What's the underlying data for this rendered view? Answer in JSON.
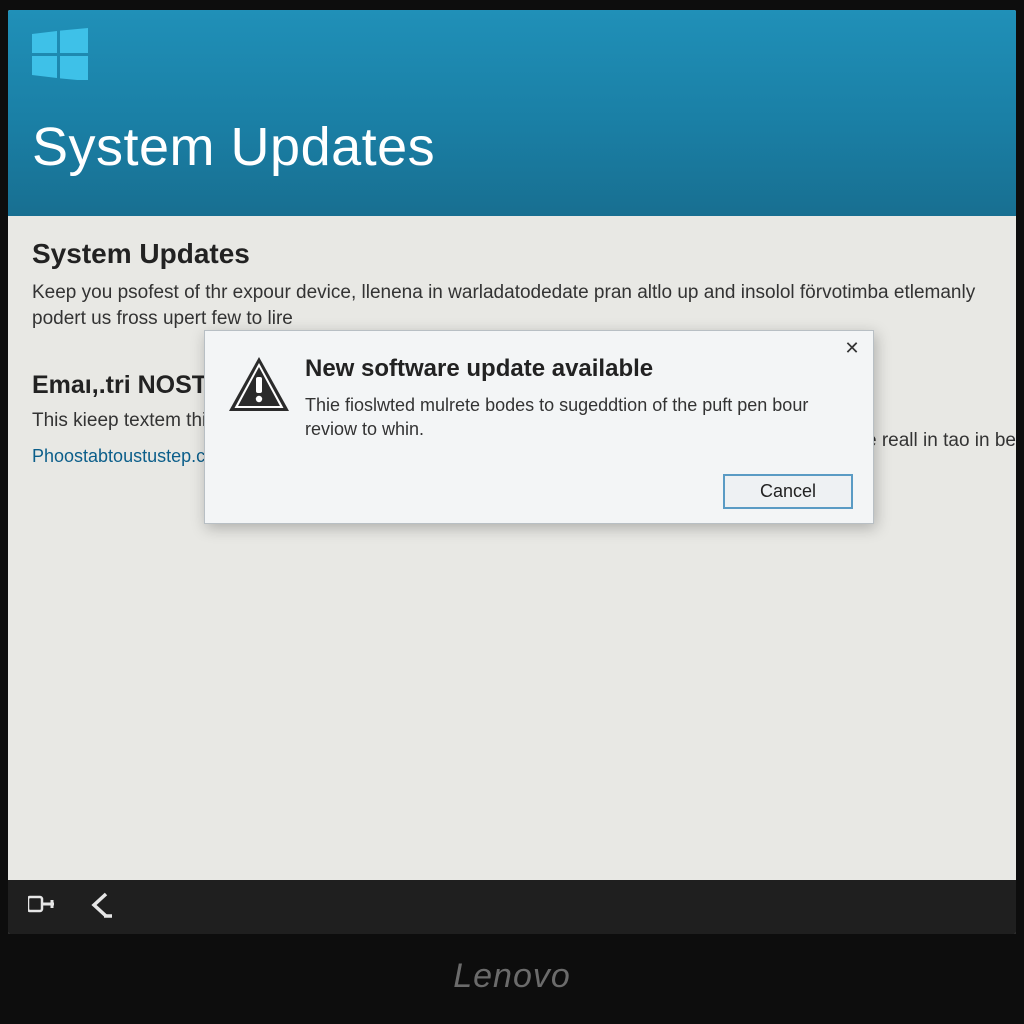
{
  "header": {
    "title": "System Updates"
  },
  "content": {
    "heading": "System Updates",
    "paragraph": "Keep you psofest of thr expour device, llenena in warladatodedate pran altlo up and insolol förvotimba etlemanly podert us fross upert few to lire",
    "sub_heading": "Emaı,.tri NOST",
    "sub_text": "This kieep textem thir",
    "link": "Phoostabtoustustep.c",
    "right_fragment": "to e reall in tao in be"
  },
  "dialog": {
    "title": "New software update available",
    "message": "Thie fioslwted mulrete bodes to sugeddtion of the puft pen bour reviow to whin.",
    "close_glyph": "✕",
    "cancel_label": "Cancel"
  },
  "monitor": {
    "brand": "Lenovo"
  }
}
